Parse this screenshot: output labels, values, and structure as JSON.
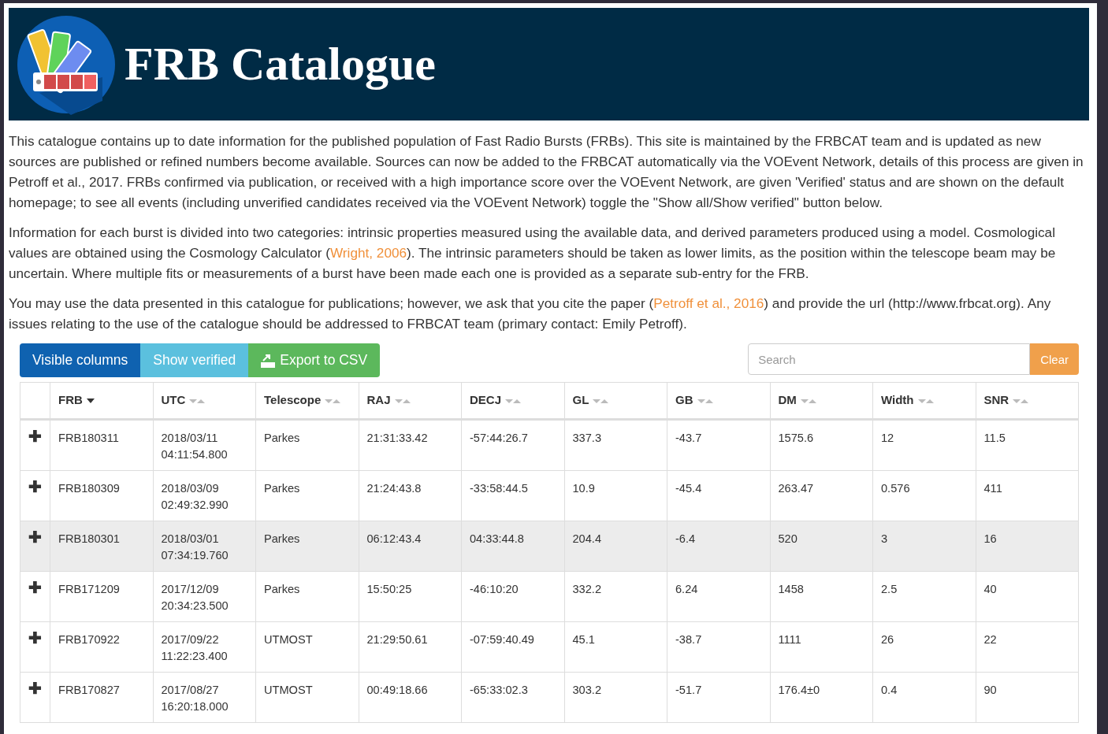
{
  "header": {
    "title": "FRB Catalogue"
  },
  "paragraphs": [
    [
      {
        "text": "This catalogue contains up to date information for the published population of Fast Radio Bursts (FRBs). This site is maintained by the FRBCAT team and is updated as new sources are published or refined numbers become available. Sources can now be added to the FRBCAT automatically via the VOEvent Network, details of this process are given in Petroff et al., 2017. FRBs confirmed via publication, or received with a high importance score over the VOEvent Network, are given 'Verified' status and are shown on the default homepage; to see all events (including unverified candidates received via the VOEvent Network) toggle the \"Show all/Show verified\" button below."
      }
    ],
    [
      {
        "text": "Information for each burst is divided into two categories: intrinsic properties measured using the available data, and derived parameters produced using a model. Cosmological values are obtained using the Cosmology Calculator ("
      },
      {
        "link": "Wright, 2006"
      },
      {
        "text": "). The intrinsic parameters should be taken as lower limits, as the position within the telescope beam may be uncertain. Where multiple fits or measurements of a burst have been made each one is provided as a separate sub-entry for the FRB."
      }
    ],
    [
      {
        "text": "You may use the data presented in this catalogue for publications; however, we ask that you cite the paper ("
      },
      {
        "link": "Petroff et al., 2016"
      },
      {
        "text": ") and provide the url (http://www.frbcat.org). Any issues relating to the use of the catalogue should be addressed to FRBCAT team (primary contact: Emily Petroff)."
      }
    ]
  ],
  "toolbar": {
    "buttons": [
      {
        "label": "Visible columns",
        "kind": "primary"
      },
      {
        "label": "Show verified",
        "kind": "info"
      },
      {
        "label": "Export to CSV",
        "kind": "success"
      }
    ],
    "search": {
      "placeholder": "Search"
    },
    "clear": "Clear"
  },
  "table": {
    "columns": [
      {
        "label": "FRB",
        "sorted": true
      },
      {
        "label": "UTC",
        "sorted": false
      },
      {
        "label": "Telescope",
        "sorted": false
      },
      {
        "label": "RAJ",
        "sorted": false
      },
      {
        "label": "DECJ",
        "sorted": false
      },
      {
        "label": "GL",
        "sorted": false
      },
      {
        "label": "GB",
        "sorted": false
      },
      {
        "label": "DM",
        "sorted": false
      },
      {
        "label": "Width",
        "sorted": false
      },
      {
        "label": "SNR",
        "sorted": false
      }
    ],
    "rows": [
      {
        "expand": "✚",
        "shaded": false,
        "cells": [
          "FRB180311",
          "2018/03/11 04:11:54.800",
          "Parkes",
          "21:31:33.42",
          "-57:44:26.7",
          "337.3",
          "-43.7",
          "1575.6",
          "12",
          "11.5"
        ]
      },
      {
        "expand": "✚",
        "shaded": false,
        "cells": [
          "FRB180309",
          "2018/03/09 02:49:32.990",
          "Parkes",
          "21:24:43.8",
          "-33:58:44.5",
          "10.9",
          "-45.4",
          "263.47",
          "0.576",
          "411"
        ]
      },
      {
        "expand": "✚",
        "shaded": true,
        "cells": [
          "FRB180301",
          "2018/03/01 07:34:19.760",
          "Parkes",
          "06:12:43.4",
          "04:33:44.8",
          "204.4",
          "-6.4",
          "520",
          "3",
          "16"
        ]
      },
      {
        "expand": "✚",
        "shaded": false,
        "cells": [
          "FRB171209",
          "2017/12/09 20:34:23.500",
          "Parkes",
          "15:50:25",
          "-46:10:20",
          "332.2",
          "6.24",
          "1458",
          "2.5",
          "40"
        ]
      },
      {
        "expand": "✚",
        "shaded": false,
        "cells": [
          "FRB170922",
          "2017/09/22 11:22:23.400",
          "UTMOST",
          "21:29:50.61",
          "-07:59:40.49",
          "45.1",
          "-38.7",
          "1111",
          "26",
          "22"
        ]
      },
      {
        "expand": "✚",
        "shaded": false,
        "cells": [
          "FRB170827",
          "2017/08/27 16:20:18.000",
          "UTMOST",
          "00:49:18.66",
          "-65:33:02.3",
          "303.2",
          "-51.7",
          "176.4±0",
          "0.4",
          "90"
        ]
      }
    ]
  }
}
